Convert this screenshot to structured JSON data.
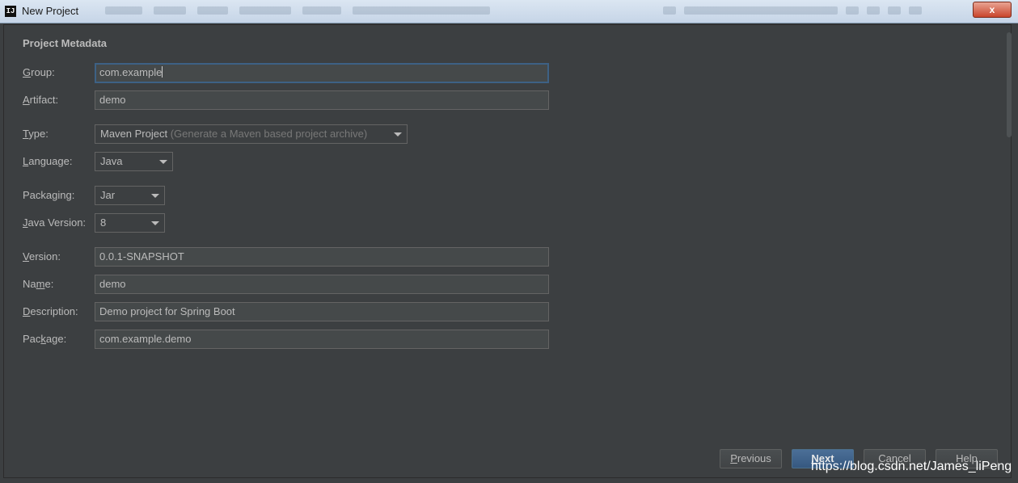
{
  "window": {
    "title": "New Project",
    "app_icon_text": "IJ",
    "close_label": "x"
  },
  "section_title": "Project Metadata",
  "form": {
    "group": {
      "mnemonic": "G",
      "rest": "roup:",
      "value": "com.example"
    },
    "artifact": {
      "pre": "",
      "mnemonic": "A",
      "rest": "rtifact:",
      "value": "demo"
    },
    "type": {
      "mnemonic": "T",
      "rest": "ype:",
      "value": "Maven Project",
      "hint": "(Generate a Maven based project archive)"
    },
    "language": {
      "mnemonic": "L",
      "rest": "anguage:",
      "value": "Java"
    },
    "packaging": {
      "pre": "Packa",
      "mnemonic": "g",
      "rest": "ing:",
      "value": "Jar"
    },
    "java_version": {
      "mnemonic": "J",
      "rest": "ava Version:",
      "value": "8"
    },
    "version": {
      "mnemonic": "V",
      "rest": "ersion:",
      "value": "0.0.1-SNAPSHOT"
    },
    "name": {
      "pre": "Na",
      "mnemonic": "m",
      "rest": "e:",
      "value": "demo"
    },
    "description": {
      "mnemonic": "D",
      "rest": "escription:",
      "value": "Demo project for Spring Boot"
    },
    "package": {
      "pre": "Pac",
      "mnemonic": "k",
      "rest": "age:",
      "value": "com.example.demo"
    }
  },
  "buttons": {
    "previous": {
      "mnemonic": "P",
      "rest": "revious"
    },
    "next": {
      "mnemonic": "N",
      "rest": "ext"
    },
    "cancel": "Cancel",
    "help": "Help"
  },
  "watermark": "https://blog.csdn.net/James_liPeng",
  "icons": {
    "dropdown": "chevron-down-icon",
    "app": "intellij-icon",
    "close": "close-icon"
  }
}
